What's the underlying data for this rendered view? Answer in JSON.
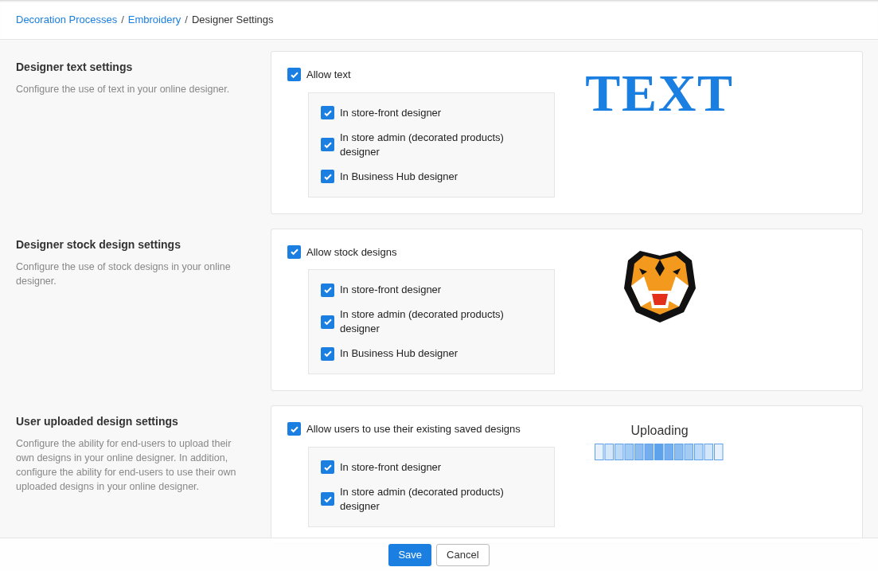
{
  "breadcrumb": [
    {
      "label": "Decoration Processes",
      "kind": "link"
    },
    {
      "label": "/",
      "kind": "separator"
    },
    {
      "label": "Embroidery",
      "kind": "link"
    },
    {
      "label": "/",
      "kind": "separator"
    },
    {
      "label": "Designer Settings",
      "kind": "current"
    }
  ],
  "sections": [
    {
      "title": "Designer text settings",
      "description": "Configure the use of text in your online designer.",
      "main_option": {
        "label": "Allow text",
        "checked": true
      },
      "options": [
        {
          "label": "In store-front designer",
          "checked": true
        },
        {
          "label": "In store admin (decorated products) designer",
          "checked": true
        },
        {
          "label": "In Business Hub designer",
          "checked": true
        }
      ],
      "preview": {
        "kind": "text",
        "text": "TEXT"
      }
    },
    {
      "title": "Designer stock design settings",
      "description": "Configure the use of stock designs in your online designer.",
      "main_option": {
        "label": "Allow stock designs",
        "checked": true
      },
      "options": [
        {
          "label": "In store-front designer",
          "checked": true
        },
        {
          "label": "In store admin (decorated products) designer",
          "checked": true
        },
        {
          "label": "In Business Hub designer",
          "checked": true
        }
      ]
    },
    {
      "title": "User uploaded design settings",
      "description": "Configure the ability for end-users to upload their own designs in your online designer. In addition, configure the ability for end-users to use their own uploaded designs in your online designer.",
      "main_option": {
        "label": "Allow users to use their existing saved designs",
        "checked": true
      },
      "options": [
        {
          "label": "In store-front designer",
          "checked": true
        },
        {
          "label": "In store admin (decorated products) designer",
          "checked": true
        }
      ],
      "preview": {
        "kind": "uploading",
        "text": "Uploading"
      }
    }
  ],
  "footer": {
    "buttons": [
      {
        "label": "Save",
        "kind": "primary"
      },
      {
        "label": "Cancel",
        "kind": "secondary"
      }
    ]
  }
}
